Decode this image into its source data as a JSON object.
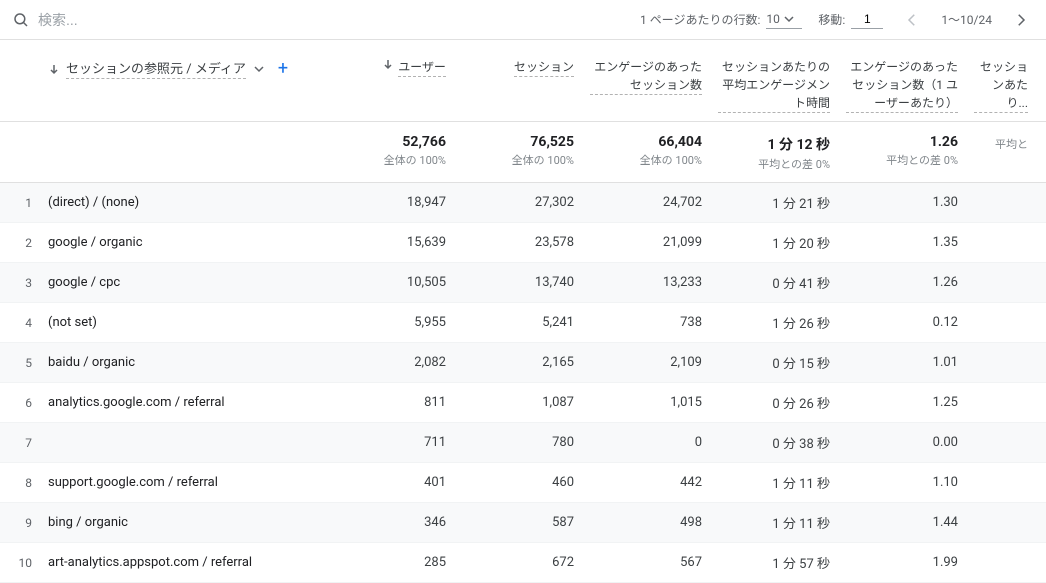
{
  "toolbar": {
    "search_placeholder": "検索...",
    "rows_per_page_label": "1 ページあたりの行数:",
    "rows_per_page_value": "10",
    "goto_label": "移動:",
    "goto_value": "1",
    "range_text": "1～10/24"
  },
  "dimension": {
    "label": "セッションの参照元 / メディア"
  },
  "metrics": [
    {
      "label": "ユーザー",
      "sorted": true
    },
    {
      "label": "セッション"
    },
    {
      "label": "エンゲージのあったセッション数"
    },
    {
      "label": "セッションあたりの平均エンゲージメント時間"
    },
    {
      "label": "エンゲージのあったセッション数（1 ユーザーあたり）"
    },
    {
      "label": "セッションあたり..."
    }
  ],
  "summary": [
    {
      "value": "52,766",
      "sub": "全体の 100%"
    },
    {
      "value": "76,525",
      "sub": "全体の 100%"
    },
    {
      "value": "66,404",
      "sub": "全体の 100%"
    },
    {
      "value": "1 分 12 秒",
      "sub": "平均との差 0%"
    },
    {
      "value": "1.26",
      "sub": "平均との差 0%"
    },
    {
      "value": "",
      "sub": "平均と"
    }
  ],
  "rows": [
    {
      "idx": "1",
      "dim": "(direct) / (none)",
      "cells": [
        "18,947",
        "27,302",
        "24,702",
        "1 分 21 秒",
        "1.30",
        ""
      ]
    },
    {
      "idx": "2",
      "dim": "google / organic",
      "cells": [
        "15,639",
        "23,578",
        "21,099",
        "1 分 20 秒",
        "1.35",
        ""
      ]
    },
    {
      "idx": "3",
      "dim": "google / cpc",
      "cells": [
        "10,505",
        "13,740",
        "13,233",
        "0 分 41 秒",
        "1.26",
        ""
      ]
    },
    {
      "idx": "4",
      "dim": "(not set)",
      "cells": [
        "5,955",
        "5,241",
        "738",
        "1 分 26 秒",
        "0.12",
        ""
      ]
    },
    {
      "idx": "5",
      "dim": "baidu / organic",
      "cells": [
        "2,082",
        "2,165",
        "2,109",
        "0 分 15 秒",
        "1.01",
        ""
      ]
    },
    {
      "idx": "6",
      "dim": "analytics.google.com / referral",
      "cells": [
        "811",
        "1,087",
        "1,015",
        "0 分 26 秒",
        "1.25",
        ""
      ]
    },
    {
      "idx": "7",
      "dim": "",
      "cells": [
        "711",
        "780",
        "0",
        "0 分 38 秒",
        "0.00",
        ""
      ]
    },
    {
      "idx": "8",
      "dim": "support.google.com / referral",
      "cells": [
        "401",
        "460",
        "442",
        "1 分 11 秒",
        "1.10",
        ""
      ]
    },
    {
      "idx": "9",
      "dim": "bing / organic",
      "cells": [
        "346",
        "587",
        "498",
        "1 分 11 秒",
        "1.44",
        ""
      ]
    },
    {
      "idx": "10",
      "dim": "art-analytics.appspot.com / referral",
      "cells": [
        "285",
        "672",
        "567",
        "1 分 57 秒",
        "1.99",
        ""
      ]
    }
  ]
}
